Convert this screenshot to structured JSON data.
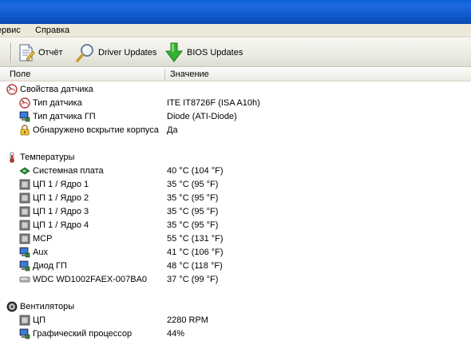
{
  "menu": {
    "service": "ервис",
    "help": "Справка"
  },
  "toolbar": {
    "report_label": "Отчёт",
    "driver_updates_label": "Driver Updates",
    "bios_updates_label": "BIOS Updates"
  },
  "columns": {
    "field": "Поле",
    "value": "Значение"
  },
  "groups": [
    {
      "title": "Свойства датчика",
      "icon": "sensor-properties-icon",
      "items": [
        {
          "name": "Тип датчика",
          "value": "ITE IT8726F  (ISA A10h)",
          "icon": "sensor-gauge-icon"
        },
        {
          "name": "Тип датчика ГП",
          "value": "Diode  (ATI-Diode)",
          "icon": "monitor-icon"
        },
        {
          "name": "Обнаружено вскрытие корпуса",
          "value": "Да",
          "icon": "lock-icon"
        }
      ]
    },
    {
      "title": "Температуры",
      "icon": "thermometer-icon",
      "items": [
        {
          "name": "Системная плата",
          "value": "40 °C  (104 °F)",
          "icon": "motherboard-icon"
        },
        {
          "name": "ЦП 1 / Ядро 1",
          "value": "35 °C  (95 °F)",
          "icon": "cpu-icon"
        },
        {
          "name": "ЦП 1 / Ядро 2",
          "value": "35 °C  (95 °F)",
          "icon": "cpu-icon"
        },
        {
          "name": "ЦП 1 / Ядро 3",
          "value": "35 °C  (95 °F)",
          "icon": "cpu-icon"
        },
        {
          "name": "ЦП 1 / Ядро 4",
          "value": "35 °C  (95 °F)",
          "icon": "cpu-icon"
        },
        {
          "name": "MCP",
          "value": "55 °C  (131 °F)",
          "icon": "cpu-icon"
        },
        {
          "name": "Aux",
          "value": "41 °C  (106 °F)",
          "icon": "monitor-icon"
        },
        {
          "name": "Диод ГП",
          "value": "48 °C  (118 °F)",
          "icon": "monitor-icon"
        },
        {
          "name": "WDC WD1002FAEX-007BA0",
          "value": "37 °C  (99 °F)",
          "icon": "hard-drive-icon"
        }
      ]
    },
    {
      "title": "Вентиляторы",
      "icon": "fan-icon",
      "items": [
        {
          "name": "ЦП",
          "value": "2280 RPM",
          "icon": "cpu-icon"
        },
        {
          "name": "Графический процессор",
          "value": "44%",
          "icon": "monitor-icon"
        }
      ]
    }
  ]
}
